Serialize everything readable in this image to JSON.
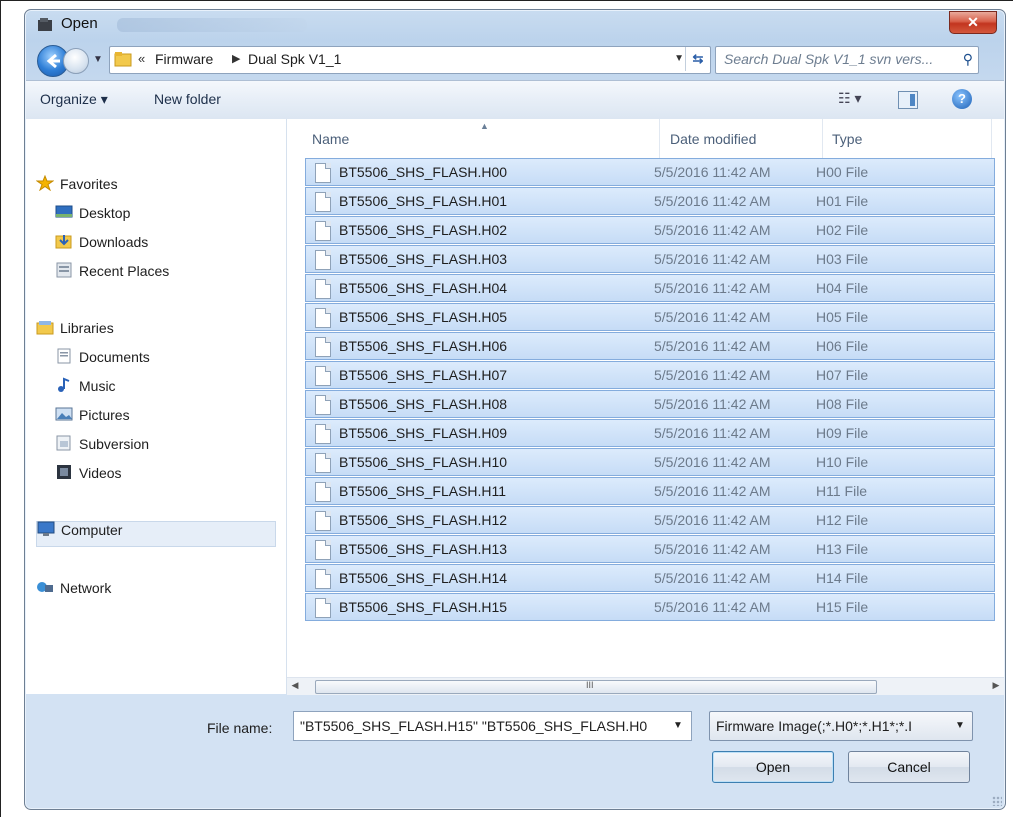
{
  "window": {
    "title": "Open"
  },
  "navigation": {
    "path": [
      "Firmware",
      "Dual Spk V1_1"
    ],
    "overflow_chevron": "«",
    "search_placeholder": "Search Dual Spk V1_1 svn vers..."
  },
  "toolbar": {
    "organize": "Organize ▾",
    "new_folder": "New folder"
  },
  "sidebar": {
    "items": [
      {
        "label": "Favorites",
        "icon": "star-icon",
        "group": true
      },
      {
        "label": "Desktop",
        "icon": "desktop-icon"
      },
      {
        "label": "Downloads",
        "icon": "downloads-icon"
      },
      {
        "label": "Recent Places",
        "icon": "recent-places-icon"
      },
      {
        "label": "Libraries",
        "icon": "library-icon",
        "group": true
      },
      {
        "label": "Documents",
        "icon": "documents-icon"
      },
      {
        "label": "Music",
        "icon": "music-icon"
      },
      {
        "label": "Pictures",
        "icon": "pictures-icon"
      },
      {
        "label": "Subversion",
        "icon": "subversion-icon"
      },
      {
        "label": "Videos",
        "icon": "videos-icon"
      },
      {
        "label": "Computer",
        "icon": "computer-icon",
        "group": true,
        "selected": true
      },
      {
        "label": "Network",
        "icon": "network-icon",
        "group": true
      }
    ]
  },
  "file_list": {
    "columns": {
      "name": "Name",
      "date": "Date modified",
      "type": "Type"
    },
    "rows": [
      {
        "name": "BT5506_SHS_FLASH.H00",
        "date": "5/5/2016 11:42 AM",
        "type": "H00 File"
      },
      {
        "name": "BT5506_SHS_FLASH.H01",
        "date": "5/5/2016 11:42 AM",
        "type": "H01 File"
      },
      {
        "name": "BT5506_SHS_FLASH.H02",
        "date": "5/5/2016 11:42 AM",
        "type": "H02 File"
      },
      {
        "name": "BT5506_SHS_FLASH.H03",
        "date": "5/5/2016 11:42 AM",
        "type": "H03 File"
      },
      {
        "name": "BT5506_SHS_FLASH.H04",
        "date": "5/5/2016 11:42 AM",
        "type": "H04 File"
      },
      {
        "name": "BT5506_SHS_FLASH.H05",
        "date": "5/5/2016 11:42 AM",
        "type": "H05 File"
      },
      {
        "name": "BT5506_SHS_FLASH.H06",
        "date": "5/5/2016 11:42 AM",
        "type": "H06 File"
      },
      {
        "name": "BT5506_SHS_FLASH.H07",
        "date": "5/5/2016 11:42 AM",
        "type": "H07 File"
      },
      {
        "name": "BT5506_SHS_FLASH.H08",
        "date": "5/5/2016 11:42 AM",
        "type": "H08 File"
      },
      {
        "name": "BT5506_SHS_FLASH.H09",
        "date": "5/5/2016 11:42 AM",
        "type": "H09 File"
      },
      {
        "name": "BT5506_SHS_FLASH.H10",
        "date": "5/5/2016 11:42 AM",
        "type": "H10 File"
      },
      {
        "name": "BT5506_SHS_FLASH.H11",
        "date": "5/5/2016 11:42 AM",
        "type": "H11 File"
      },
      {
        "name": "BT5506_SHS_FLASH.H12",
        "date": "5/5/2016 11:42 AM",
        "type": "H12 File"
      },
      {
        "name": "BT5506_SHS_FLASH.H13",
        "date": "5/5/2016 11:42 AM",
        "type": "H13 File"
      },
      {
        "name": "BT5506_SHS_FLASH.H14",
        "date": "5/5/2016 11:42 AM",
        "type": "H14 File"
      },
      {
        "name": "BT5506_SHS_FLASH.H15",
        "date": "5/5/2016 11:42 AM",
        "type": "H15 File"
      }
    ]
  },
  "scrollbar": {
    "grip": "III"
  },
  "footer": {
    "file_name_label": "File name:",
    "file_name_value": "\"BT5506_SHS_FLASH.H15\" \"BT5506_SHS_FLASH.H0",
    "filter_value": "Firmware Image(;*.H0*;*.H1*;*.I",
    "open_label": "Open",
    "cancel_label": "Cancel"
  },
  "colors": {
    "selection": "#c6dcf6",
    "selection_border": "#84acdd",
    "accent": "#2e7ed6",
    "close": "#c2351f"
  }
}
